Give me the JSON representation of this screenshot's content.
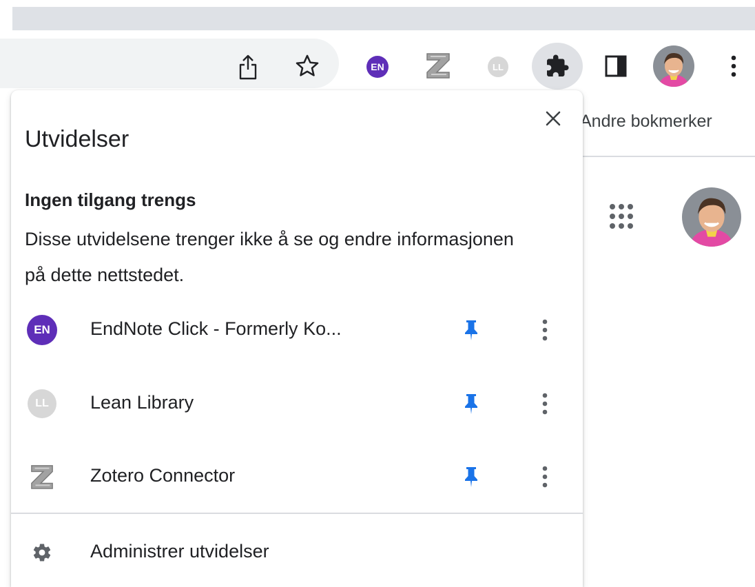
{
  "toolbar": {
    "extension_badges": {
      "endnote": "EN",
      "lean_library": "LL"
    },
    "icons": [
      "share-icon",
      "bookmark-star-icon",
      "endnote-extension-icon",
      "zotero-extension-icon",
      "lean-library-extension-icon",
      "extensions-puzzle-icon",
      "side-panel-icon",
      "profile-avatar",
      "chrome-menu-icon"
    ]
  },
  "bookmarks_bar": {
    "other_bookmarks": "Andre bokmerker"
  },
  "extensions_panel": {
    "title": "Utvidelser",
    "section": {
      "heading": "Ingen tilgang trengs",
      "description": "Disse utvidelsene trenger ikke å se og endre informasjonen på dette nettstedet."
    },
    "items": [
      {
        "name": "EndNote Click - Formerly Ko...",
        "icon_label": "EN",
        "pinned": true
      },
      {
        "name": "Lean Library",
        "icon_label": "LL",
        "pinned": true
      },
      {
        "name": "Zotero Connector",
        "icon_label": "Z",
        "pinned": true
      }
    ],
    "manage_label": "Administrer utvidelser"
  },
  "colors": {
    "pin": "#1a73e8",
    "endnote": "#5e2eb8",
    "lean_library": "#d7d7d7",
    "tabstrip": "#dee1e6",
    "omnibox": "#f1f3f4",
    "icon": "#5f6368"
  }
}
